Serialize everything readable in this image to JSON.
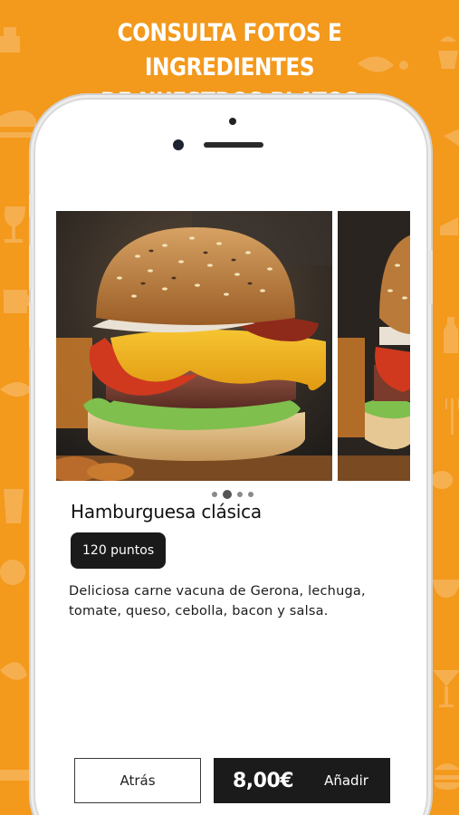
{
  "promo": {
    "title_line1": "CONSULTA FOTOS E INGREDIENTES",
    "title_line2": "DE NUESTROS PLATOS"
  },
  "product": {
    "name": "Hamburguesa clásica",
    "points": "120 puntos",
    "description": "Deliciosa carne vacuna de Gerona, lechuga, tomate, queso, cebolla, bacon y salsa.",
    "gallery": {
      "image_count": 4,
      "active_index": 1
    }
  },
  "actions": {
    "back_label": "Atrás",
    "price": "8,00€",
    "add_label": "Añadir"
  },
  "colors": {
    "background": "#f3991c",
    "button_dark": "#1b1b1b",
    "badge": "#1a1a1a"
  }
}
